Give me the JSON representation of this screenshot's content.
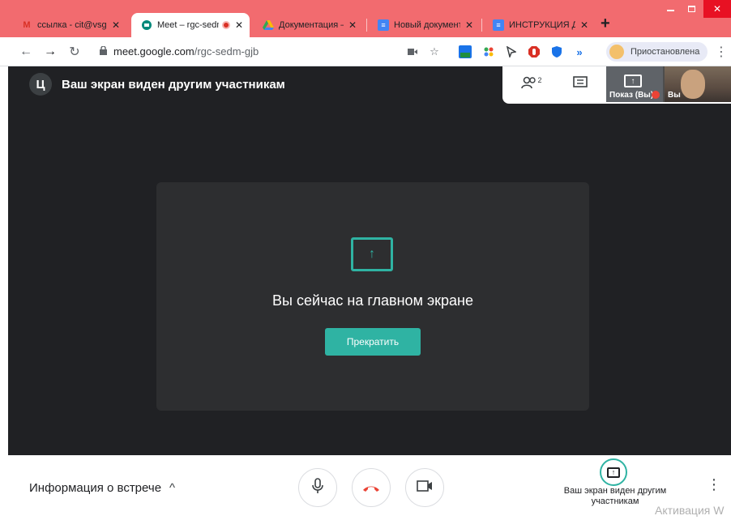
{
  "tabs": [
    {
      "title": "ссылка - cit@vsgu",
      "icon": "gmail-icon"
    },
    {
      "title": "Meet – rgc-sedm",
      "icon": "meet-icon"
    },
    {
      "title": "Документация – G",
      "icon": "drive-icon"
    },
    {
      "title": "Новый документ",
      "icon": "docs-icon"
    },
    {
      "title": "ИНСТРУКЦИЯ ДЛ",
      "icon": "docs-icon"
    }
  ],
  "close_glyph": "✕",
  "newtab_glyph": "+",
  "address": {
    "host": "meet.google.com",
    "path": "/rgc-sedm-gjb"
  },
  "profile": {
    "status": "Приостановлена"
  },
  "banner": {
    "initial": "Ц",
    "text": "Ваш экран виден другим участникам"
  },
  "topright": {
    "participants_count": "2",
    "tile_label_present": "Показ (Вы)",
    "tile_label_me": "Вы"
  },
  "center": {
    "title": "Вы сейчас на главном экране",
    "stop_label": "Прекратить"
  },
  "bottom": {
    "meeting_info": "Информация о встрече",
    "share_line1": "Ваш экран виден другим",
    "share_line2": "участникам"
  },
  "watermark": "Активация W",
  "colors": {
    "tabstrip": "#f26b6f",
    "meet_bg": "#202124",
    "accent": "#2fb3a3",
    "hangup": "#ea4335"
  }
}
